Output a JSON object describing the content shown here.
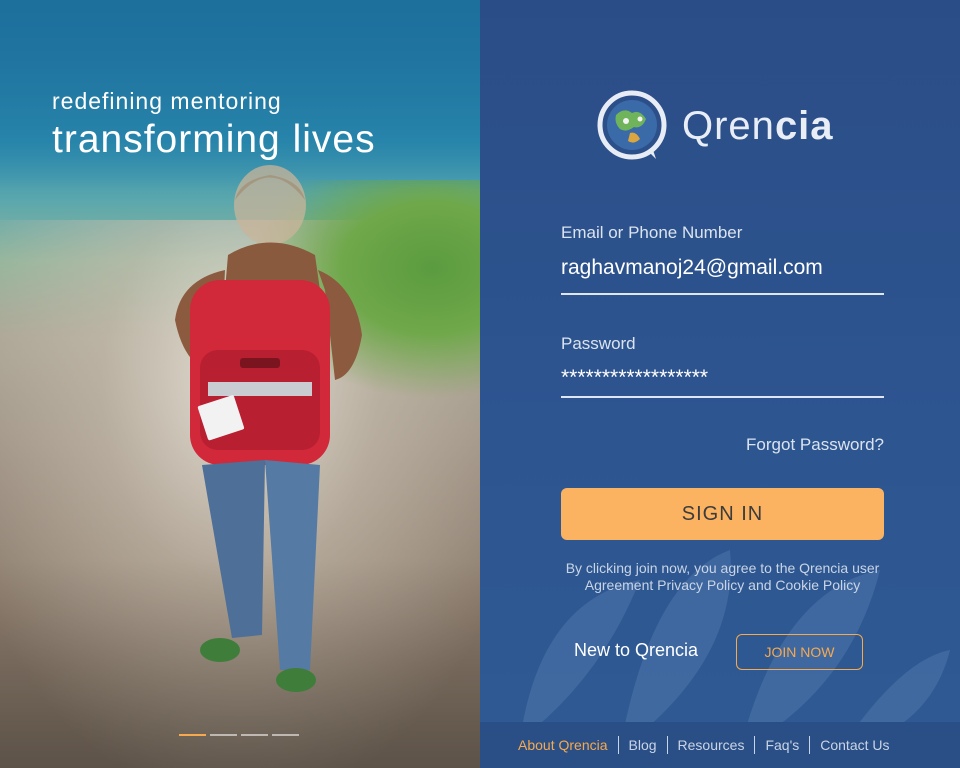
{
  "hero": {
    "tagline_small": "redefining mentoring",
    "tagline_large": "transforming lives",
    "carousel": {
      "count": 4,
      "active_index": 0
    }
  },
  "brand": {
    "name_light": "Qren",
    "name_bold": "cia"
  },
  "login": {
    "email": {
      "label": "Email or Phone Number",
      "value": "raghavmanoj24@gmail.com"
    },
    "password": {
      "label": "Password",
      "value": "******************"
    },
    "forgot_label": "Forgot Password?",
    "signin_label": "SIGN IN",
    "legal_text": "By clicking join now, you agree to the Qrencia user Agreement Privacy Policy and Cookie Policy",
    "new_to_label": "New to Qrencia",
    "join_label": "JOIN NOW"
  },
  "footer": {
    "links": [
      "About Qrencia",
      "Blog",
      "Resources",
      "Faq's",
      "Contact Us"
    ]
  },
  "colors": {
    "panel_bg": "#2b4d87",
    "accent": "#f6a94e",
    "signin_bg": "#fbb261"
  },
  "icons": [
    "globe-logo-icon"
  ]
}
